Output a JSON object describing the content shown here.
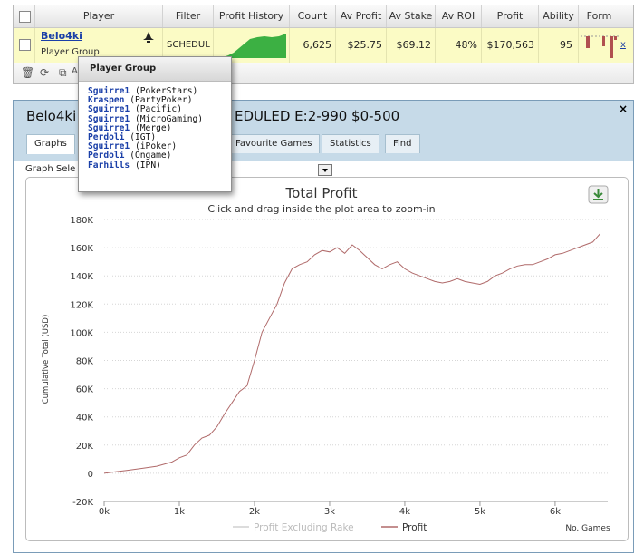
{
  "table": {
    "headers": [
      "Player",
      "Filter",
      "Profit History",
      "Count",
      "Av Profit",
      "Av Stake",
      "Av ROI",
      "Profit",
      "Ability",
      "Form"
    ],
    "row": {
      "player_name": "Belo4ki",
      "player_sub": "Player Group",
      "filter": "SCHEDUL",
      "count": "6,625",
      "av_profit": "$25.75",
      "av_stake": "$69.12",
      "av_roi": "48%",
      "profit": "$170,563",
      "ability": "95",
      "action": "x"
    },
    "toolbar_text": "A"
  },
  "popup": {
    "title": "Player Group",
    "items": [
      {
        "name": "Sguirre1",
        "site": "(PokerStars)"
      },
      {
        "name": "Kraspen",
        "site": "(PartyPoker)"
      },
      {
        "name": "Sguirre1",
        "site": "(Pacific)"
      },
      {
        "name": "Sguirre1",
        "site": "(MicroGaming)"
      },
      {
        "name": "Sguirre1",
        "site": "(Merge)"
      },
      {
        "name": "Perdoli",
        "site": "(IGT)"
      },
      {
        "name": "Sguirre1",
        "site": "(iPoker)"
      },
      {
        "name": "Perdoli",
        "site": "(Ongame)"
      },
      {
        "name": "Farhills",
        "site": "(IPN)"
      }
    ]
  },
  "window": {
    "title_left": "Belo4ki",
    "title_right": "EDULED E:2-990 $0-500",
    "close": "×",
    "tabs": [
      "Graphs",
      "Favourite Games",
      "Statistics",
      "Find"
    ],
    "graph_select_label": "Graph Sele"
  },
  "colors": {
    "profit_line": "#b06a6a",
    "fill_green": "#3cb043",
    "form_bar": "#b05050",
    "title_bar": "#c6dae8"
  },
  "chart_data": {
    "type": "line",
    "title": "Total Profit",
    "subtitle": "Click and drag inside the plot area to zoom-in",
    "xlabel": "No. Games",
    "ylabel": "Cumulative Total (USD)",
    "ylim": [
      -20000,
      180000
    ],
    "xlim": [
      0,
      6700
    ],
    "y_ticks": [
      "-20K",
      "0",
      "20K",
      "40K",
      "60K",
      "80K",
      "100K",
      "120K",
      "140K",
      "160K",
      "180K"
    ],
    "x_ticks": [
      "0k",
      "1k",
      "2k",
      "3k",
      "4k",
      "5k",
      "6k"
    ],
    "legend": [
      "Profit Excluding Rake",
      "Profit"
    ],
    "grid": true,
    "series": [
      {
        "name": "Profit",
        "values": [
          [
            0,
            0
          ],
          [
            150,
            1000
          ],
          [
            300,
            2000
          ],
          [
            500,
            3500
          ],
          [
            700,
            5000
          ],
          [
            900,
            8000
          ],
          [
            1000,
            11000
          ],
          [
            1100,
            13000
          ],
          [
            1200,
            20000
          ],
          [
            1300,
            25000
          ],
          [
            1400,
            27000
          ],
          [
            1500,
            33000
          ],
          [
            1600,
            42000
          ],
          [
            1700,
            50000
          ],
          [
            1800,
            58000
          ],
          [
            1900,
            62000
          ],
          [
            2000,
            80000
          ],
          [
            2100,
            100000
          ],
          [
            2200,
            110000
          ],
          [
            2300,
            120000
          ],
          [
            2400,
            135000
          ],
          [
            2500,
            145000
          ],
          [
            2600,
            148000
          ],
          [
            2700,
            150000
          ],
          [
            2800,
            155000
          ],
          [
            2900,
            158000
          ],
          [
            3000,
            157000
          ],
          [
            3100,
            160000
          ],
          [
            3200,
            156000
          ],
          [
            3300,
            162000
          ],
          [
            3400,
            158000
          ],
          [
            3500,
            153000
          ],
          [
            3600,
            148000
          ],
          [
            3700,
            145000
          ],
          [
            3800,
            148000
          ],
          [
            3900,
            150000
          ],
          [
            4000,
            145000
          ],
          [
            4100,
            142000
          ],
          [
            4200,
            140000
          ],
          [
            4300,
            138000
          ],
          [
            4400,
            136000
          ],
          [
            4500,
            135000
          ],
          [
            4600,
            136000
          ],
          [
            4700,
            138000
          ],
          [
            4800,
            136000
          ],
          [
            4900,
            135000
          ],
          [
            5000,
            134000
          ],
          [
            5100,
            136000
          ],
          [
            5200,
            140000
          ],
          [
            5300,
            142000
          ],
          [
            5400,
            145000
          ],
          [
            5500,
            147000
          ],
          [
            5600,
            148000
          ],
          [
            5700,
            148000
          ],
          [
            5800,
            150000
          ],
          [
            5900,
            152000
          ],
          [
            6000,
            155000
          ],
          [
            6100,
            156000
          ],
          [
            6200,
            158000
          ],
          [
            6300,
            160000
          ],
          [
            6400,
            162000
          ],
          [
            6500,
            164000
          ],
          [
            6600,
            170000
          ]
        ]
      }
    ]
  }
}
